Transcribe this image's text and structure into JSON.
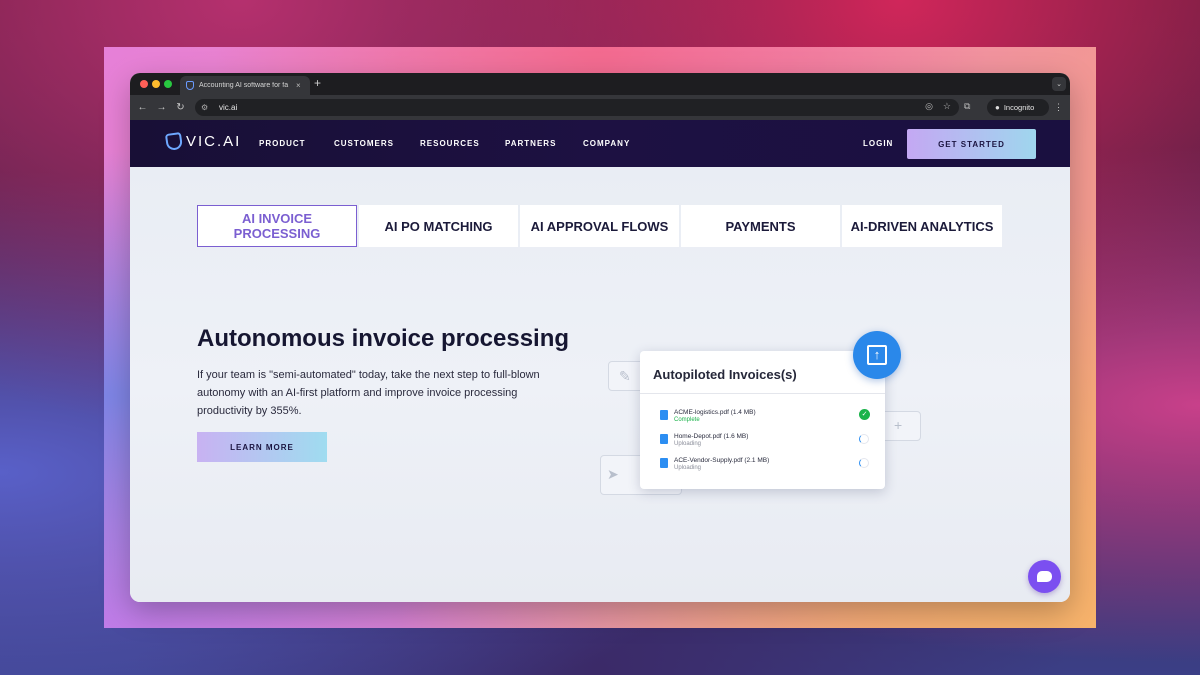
{
  "browser": {
    "tab_title": "Accounting AI software for fa",
    "new_tab": "+",
    "url": "vic.ai",
    "incognito_label": "Incognito"
  },
  "header": {
    "logo_text": "VIC.AI",
    "nav": [
      "PRODUCT",
      "CUSTOMERS",
      "RESOURCES",
      "PARTNERS",
      "COMPANY"
    ],
    "login": "LOGIN",
    "cta": "GET STARTED"
  },
  "feature_tabs": [
    {
      "label": "AI INVOICE PROCESSING",
      "active": true
    },
    {
      "label": "AI PO MATCHING",
      "active": false
    },
    {
      "label": "AI APPROVAL FLOWS",
      "active": false
    },
    {
      "label": "PAYMENTS",
      "active": false
    },
    {
      "label": "AI-DRIVEN ANALYTICS",
      "active": false
    }
  ],
  "hero": {
    "title": "Autonomous invoice processing",
    "body": "If your team is \"semi-automated\" today, take the next step to full-blown autonomy with an AI-first platform and improve invoice processing productivity by 355%.",
    "button": "LEARN MORE"
  },
  "upload_card": {
    "title": "Autopiloted Invoices(s)",
    "files": [
      {
        "name": "ACME-logistics.pdf (1.4 MB)",
        "status": "Complete",
        "state": "complete"
      },
      {
        "name": "Home-Depot.pdf (1.6 MB)",
        "status": "Uploading",
        "state": "uploading"
      },
      {
        "name": "ACE-Vendor-Supply.pdf (2.1 MB)",
        "status": "Uploading",
        "state": "uploading"
      }
    ]
  },
  "colors": {
    "accent": "#7b5fd1",
    "header_bg": "#1a1040",
    "upload_blue": "#2a88ea",
    "complete_green": "#1ab34a",
    "chat_purple": "#7b4ff0"
  },
  "icons": [
    "back-icon",
    "forward-icon",
    "reload-icon",
    "site-settings-icon",
    "eye-off-icon",
    "star-icon",
    "extensions-icon",
    "incognito-icon",
    "menu-icon",
    "upload-icon",
    "file-icon",
    "check-icon",
    "spinner-icon",
    "chat-icon"
  ]
}
